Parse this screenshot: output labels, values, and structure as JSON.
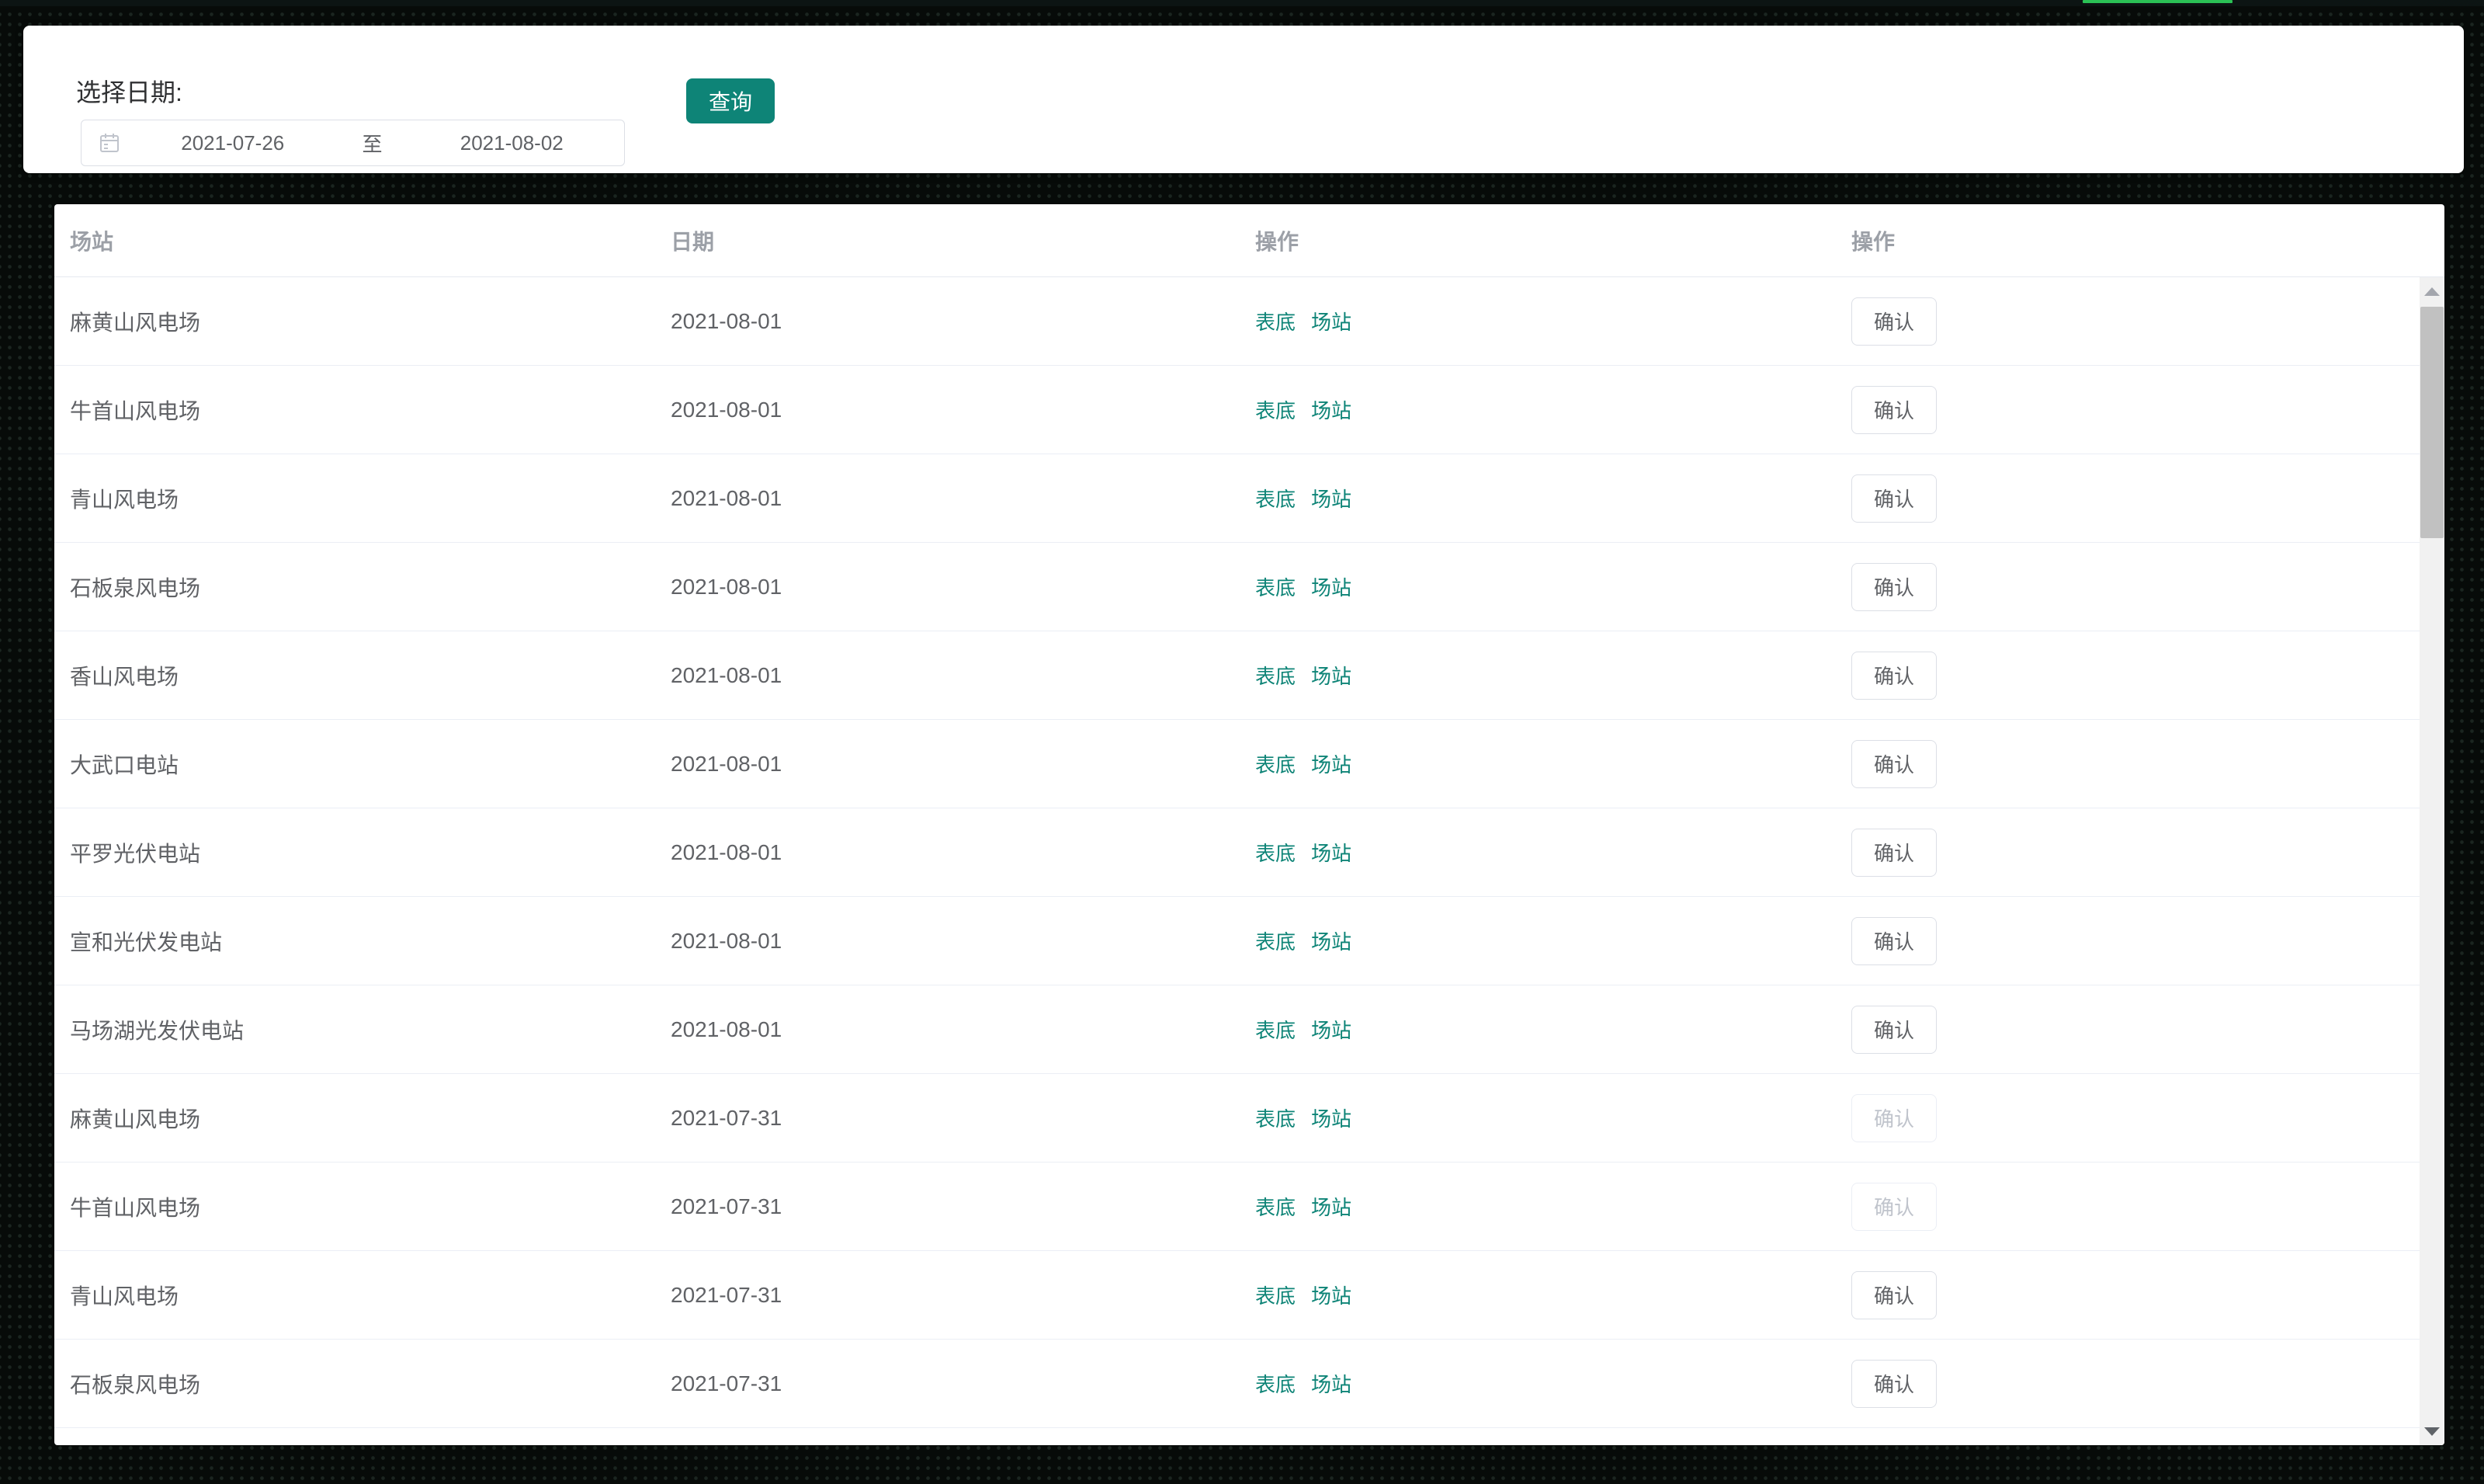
{
  "colors": {
    "accent": "#0e8477",
    "link": "#0e8477",
    "green-bar": "#2bc155",
    "cell-text": "#606266",
    "header-text": "#9ca0a7",
    "row-border": "#ebeef5",
    "btn-border": "#dcdfe6",
    "disabled-text": "#c0c4cc",
    "disabled-border": "#ebeef5"
  },
  "filter": {
    "label": "选择日期:",
    "start_date": "2021-07-26",
    "separator": "至",
    "end_date": "2021-08-02",
    "query_button": "查询",
    "calendar_icon": "calendar-icon"
  },
  "table": {
    "headers": [
      "场站",
      "日期",
      "操作",
      "操作"
    ],
    "link_labels": [
      "表底",
      "场站"
    ],
    "confirm_label": "确认",
    "rows": [
      {
        "station": "麻黄山风电场",
        "date": "2021-08-01",
        "confirm_enabled": true
      },
      {
        "station": "牛首山风电场",
        "date": "2021-08-01",
        "confirm_enabled": true
      },
      {
        "station": "青山风电场",
        "date": "2021-08-01",
        "confirm_enabled": true
      },
      {
        "station": "石板泉风电场",
        "date": "2021-08-01",
        "confirm_enabled": true
      },
      {
        "station": "香山风电场",
        "date": "2021-08-01",
        "confirm_enabled": true
      },
      {
        "station": "大武口电站",
        "date": "2021-08-01",
        "confirm_enabled": true
      },
      {
        "station": "平罗光伏电站",
        "date": "2021-08-01",
        "confirm_enabled": true
      },
      {
        "station": "宣和光伏发电站",
        "date": "2021-08-01",
        "confirm_enabled": true
      },
      {
        "station": "马场湖光发伏电站",
        "date": "2021-08-01",
        "confirm_enabled": true
      },
      {
        "station": "麻黄山风电场",
        "date": "2021-07-31",
        "confirm_enabled": false
      },
      {
        "station": "牛首山风电场",
        "date": "2021-07-31",
        "confirm_enabled": false
      },
      {
        "station": "青山风电场",
        "date": "2021-07-31",
        "confirm_enabled": true
      },
      {
        "station": "石板泉风电场",
        "date": "2021-07-31",
        "confirm_enabled": true
      }
    ]
  }
}
